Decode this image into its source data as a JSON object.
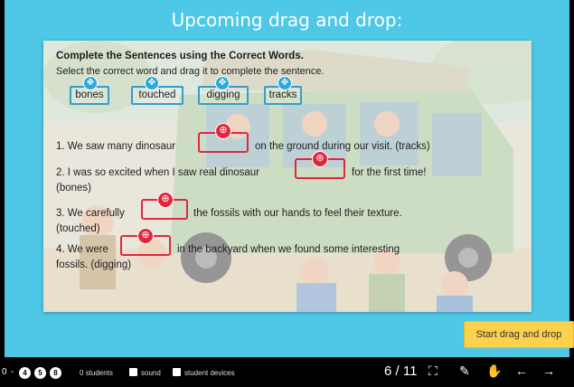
{
  "slide": {
    "title": "Upcoming drag and drop:",
    "heading": "Complete the Sentences using the Correct Words.",
    "instruction": "Select the correct word and drag it to complete the sentence.",
    "words": [
      "bones",
      "touched",
      "digging",
      "tracks"
    ],
    "sentences": [
      {
        "before": "1. We saw many dinosaur",
        "after": "on the ground during our visit. (tracks)"
      },
      {
        "before": "2. I was so excited when I saw real dinosaur",
        "after": "for the first time!",
        "line2": "(bones)"
      },
      {
        "before": "3. We carefully",
        "after": "the fossils with our hands to feel their texture.",
        "line2": "(touched)"
      },
      {
        "before": "4. We were",
        "after": "in the backyard when we found some interesting",
        "line2": "fossils. (digging)"
      }
    ],
    "start_button": "Start drag and drop"
  },
  "toolbar": {
    "count_zero": "0",
    "dash": "-",
    "badges": [
      "4",
      "5",
      "8"
    ],
    "students": "0 students",
    "sound": "sound",
    "student_devices": "student devices",
    "page": "6 / 11"
  },
  "icons": {
    "move_handle": "move-icon",
    "target_handle": "target-icon",
    "fullscreen": "fullscreen-icon",
    "pen": "pen-icon",
    "hand": "raise-hand-icon",
    "prev": "arrow-left-icon",
    "next": "arrow-right-icon"
  },
  "colors": {
    "stage": "#4ec8e6",
    "word_border": "#2f9fd0",
    "drop_border": "#e0283c",
    "button": "#fcd24c"
  }
}
